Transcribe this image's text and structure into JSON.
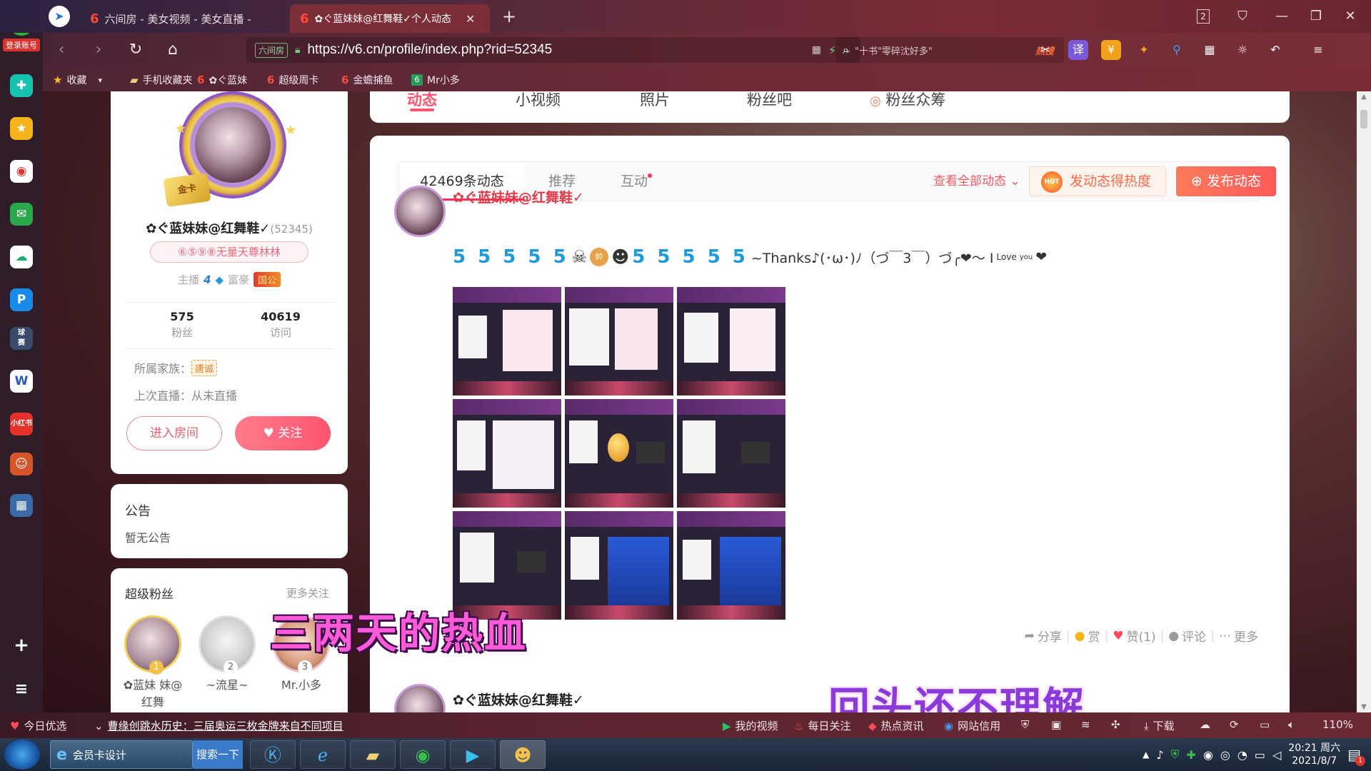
{
  "browser": {
    "tabs": [
      {
        "label": "六间房 - 美女视频 - 美女直播 -",
        "active": false
      },
      {
        "label": "✿ぐ蓝妹妹@红舞鞋✓个人动态",
        "active": true
      }
    ],
    "new_tab_label": "+",
    "window_badge": "2",
    "url": "https://v6.cn/profile/index.php?rid=52345",
    "site_tag": "六间房",
    "search_placeholder": "\"十书\"零碎沈好多\"",
    "search_hot": "热搜",
    "bookmarks": [
      {
        "label": "收藏",
        "icon": "star-icon"
      },
      {
        "label": "手机收藏夹",
        "icon": "folder-icon"
      },
      {
        "label": "✿ぐ蓝妹",
        "icon": "six-icon"
      },
      {
        "label": "超级周卡",
        "icon": "six-icon"
      },
      {
        "label": "金蟾捕鱼",
        "icon": "six-icon"
      },
      {
        "label": "Mr小多",
        "icon": "six-icon"
      }
    ],
    "side_logo_label": "登录账号"
  },
  "profile": {
    "gold_card": "金卡",
    "name": "✿ぐ蓝妹妹@红舞鞋✓",
    "rid": "(52345)",
    "title_badge": "⑥⑤⑨⑧无量天尊林林",
    "host_label": "主播",
    "host_level": "4",
    "rich_label": "富豪",
    "rich_level": "国公",
    "fans_count": "575",
    "fans_label": "粉丝",
    "visits_count": "40619",
    "visits_label": "访问",
    "family_label": "所属家族：",
    "family_name": "唐诚",
    "last_live": "上次直播：从未直播",
    "enter_room": "进入房间",
    "follow": "关注"
  },
  "notice": {
    "title": "公告",
    "body": "暂无公告"
  },
  "super_fans": {
    "title": "超级粉丝",
    "more": "更多关注",
    "fans": [
      {
        "rank": "1",
        "name": "✿蓝妹 妹@红舞"
      },
      {
        "rank": "2",
        "name": "~流星~"
      },
      {
        "rank": "3",
        "name": "Mr.小多"
      }
    ]
  },
  "page_tabs": [
    {
      "label": "动态",
      "active": true
    },
    {
      "label": "小视频",
      "active": false
    },
    {
      "label": "照片",
      "active": false
    },
    {
      "label": "粉丝吧",
      "active": false
    },
    {
      "label": "粉丝众筹",
      "active": false
    }
  ],
  "feed": {
    "subtabs": [
      {
        "label": "42469条动态",
        "active": true
      },
      {
        "label": "推荐",
        "active": false
      },
      {
        "label": "互动",
        "active": false
      }
    ],
    "view_all": "查看全部动态",
    "heat_button": "发动态得热度",
    "hot_badge": "HOT",
    "post_button": "发布动态",
    "post": {
      "author": "✿ぐ蓝妹妹@红舞鞋✓",
      "deco": "5 5 5 5 5",
      "deco2": "5 5 5 5 5",
      "text": "~Thanks♪(･ω･)ﾉ（づ￣3￣）づ╭❤～ I",
      "love": "Love",
      "you": "you",
      "heart": "❤"
    },
    "actions": {
      "share": "分享",
      "reward": "赏",
      "like": "赞(1)",
      "comment": "评论",
      "more": "更多"
    },
    "next_post_author": "✿ぐ蓝妹妹@红舞鞋✓"
  },
  "captions": {
    "first": "三两天的热血",
    "second": "回头还不理解"
  },
  "statusbar": {
    "today": "今日优选",
    "news": "曹缘创跳水历史：三届奥运三枚金牌来自不同项目",
    "my_video": "我的视频",
    "daily_follow": "每日关注",
    "hot_news": "热点资讯",
    "site_credit": "网站信用",
    "download": "下载",
    "zoom": "110%"
  },
  "taskbar": {
    "ie_label": "会员卡设计",
    "search_label": "搜索一下",
    "time": "20:21 周六",
    "date": "2021/8/7",
    "notif_count": "1"
  },
  "colors": {
    "accent": "#ff5570",
    "author_red": "#e43a4a",
    "chrome_maroon": "#7b2e36"
  }
}
